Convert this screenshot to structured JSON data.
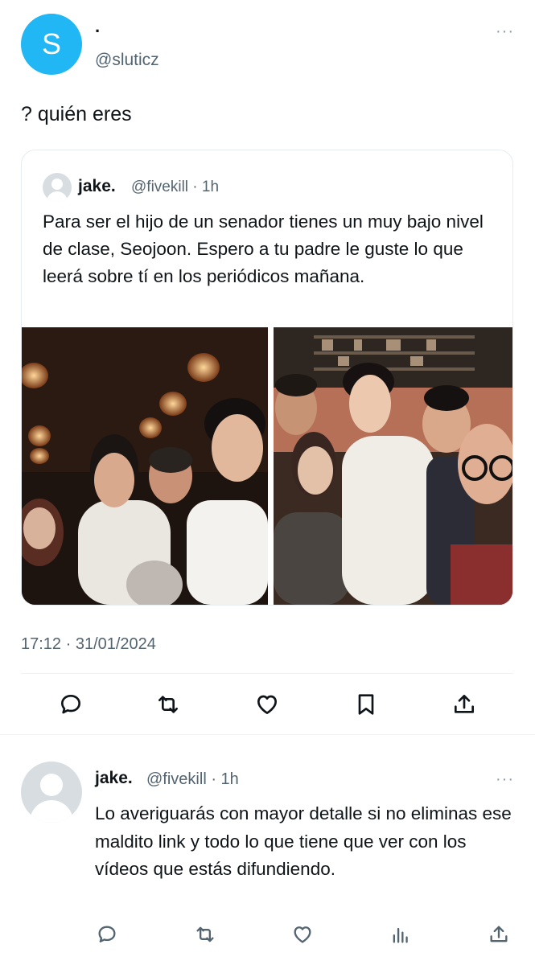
{
  "tweet": {
    "avatar_letter": "S",
    "display_name": "·",
    "handle": "@sluticz",
    "more": "···",
    "text": "? quién eres",
    "timestamp": "17:12 · 31/01/2024"
  },
  "quote": {
    "name": "jake.",
    "handle_time": "@fivekill · 1h",
    "text": "Para ser el hijo de un senador tienes un muy bajo nivel de clase, Seojoon. Espero a tu padre le guste lo que leerá sobre tí en los periódicos mañana."
  },
  "actions": [
    "reply-icon",
    "retweet-icon",
    "like-icon",
    "bookmark-icon",
    "share-icon"
  ],
  "reply": {
    "name": "jake.",
    "handle_time": "@fivekill · 1h",
    "more": "···",
    "text": "Lo averiguarás con mayor detalle si no eliminas ese maldito link y todo lo que tiene que ver con los vídeos que estás difundiendo.",
    "actions": [
      "reply-icon",
      "retweet-icon",
      "like-icon",
      "views-icon",
      "share-icon"
    ]
  },
  "colors": {
    "accent": "#21b6f4",
    "secondary_text": "#536471",
    "border": "#eff3f4"
  }
}
